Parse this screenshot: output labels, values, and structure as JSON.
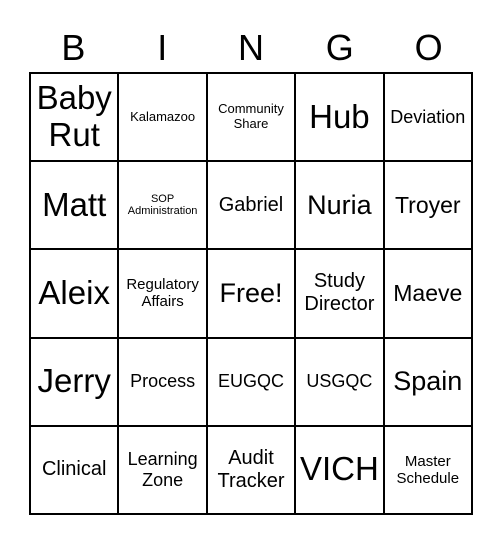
{
  "card": {
    "header": [
      "B",
      "I",
      "N",
      "G",
      "O"
    ],
    "rows": [
      [
        "Baby Rut",
        "Kalamazoo",
        "Community Share",
        "Hub",
        "Deviation"
      ],
      [
        "Matt",
        "SOP Administration",
        "Gabriel",
        "Nuria",
        "Troyer"
      ],
      [
        "Aleix",
        "Regulatory Affairs",
        "Free!",
        "Study Director",
        "Maeve"
      ],
      [
        "Jerry",
        "Process",
        "EUGQC",
        "USGQC",
        "Spain"
      ],
      [
        "Clinical",
        "Learning Zone",
        "Audit Tracker",
        "VICH",
        "Master Schedule"
      ]
    ],
    "free_space": "Free!"
  }
}
